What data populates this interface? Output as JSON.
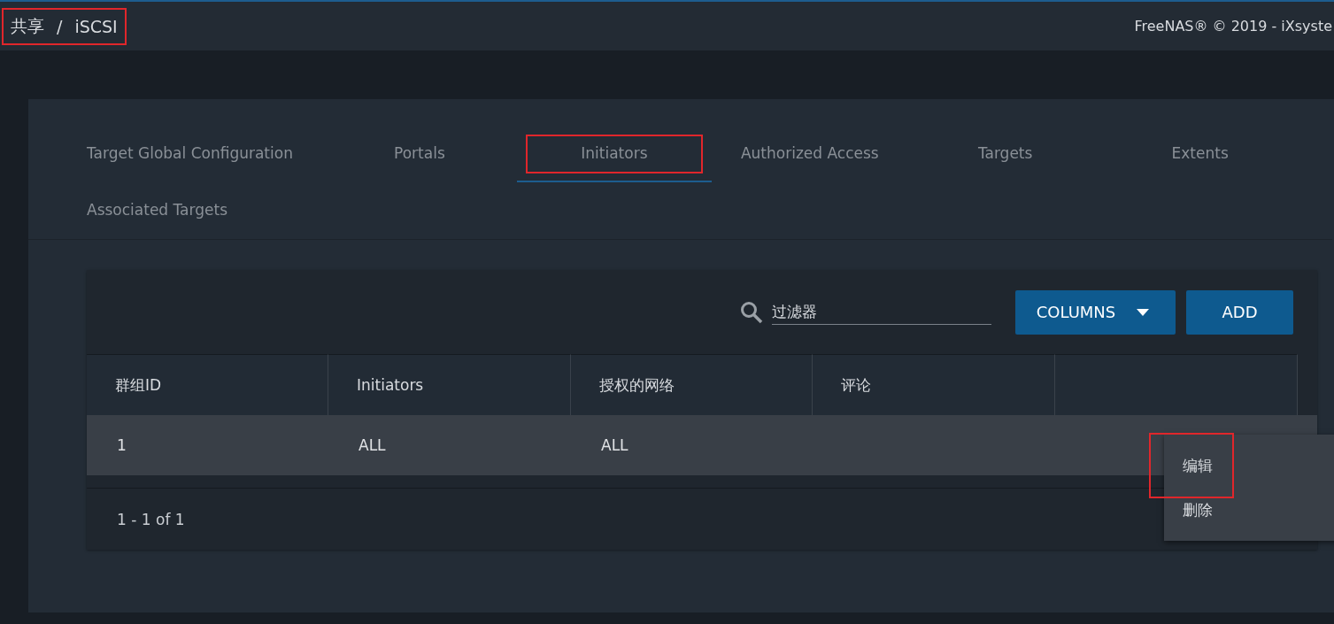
{
  "topbar": {
    "breadcrumb": {
      "items": [
        "共享",
        "iSCSI"
      ],
      "separator": "/",
      "highlighted": true
    },
    "copyright": "FreeNAS® © 2019 - iXsyste"
  },
  "tabs": [
    {
      "label": "Target Global Configuration",
      "selected": false,
      "highlighted": false
    },
    {
      "label": "Portals",
      "selected": false,
      "highlighted": false
    },
    {
      "label": "Initiators",
      "selected": true,
      "highlighted": true
    },
    {
      "label": "Authorized Access",
      "selected": false,
      "highlighted": false
    },
    {
      "label": "Targets",
      "selected": false,
      "highlighted": false
    },
    {
      "label": "Extents",
      "selected": false,
      "highlighted": false
    },
    {
      "label": "Associated Targets",
      "selected": false,
      "highlighted": false
    }
  ],
  "toolbar": {
    "search": {
      "placeholder": "过滤器"
    },
    "buttons": [
      {
        "label": "COLUMNS",
        "kind": "dropdown"
      },
      {
        "label": "ADD",
        "kind": "plain"
      }
    ]
  },
  "table": {
    "columns": [
      "群组ID",
      "Initiators",
      "授权的网络",
      "评论"
    ],
    "rows": [
      {
        "cells": [
          "1",
          "ALL",
          "ALL",
          ""
        ],
        "selected": true
      }
    ],
    "pagination": "1 - 1 of 1"
  },
  "context_menu": {
    "items": [
      {
        "label": "编辑",
        "highlighted": true
      },
      {
        "label": "删除",
        "highlighted": false
      }
    ]
  }
}
